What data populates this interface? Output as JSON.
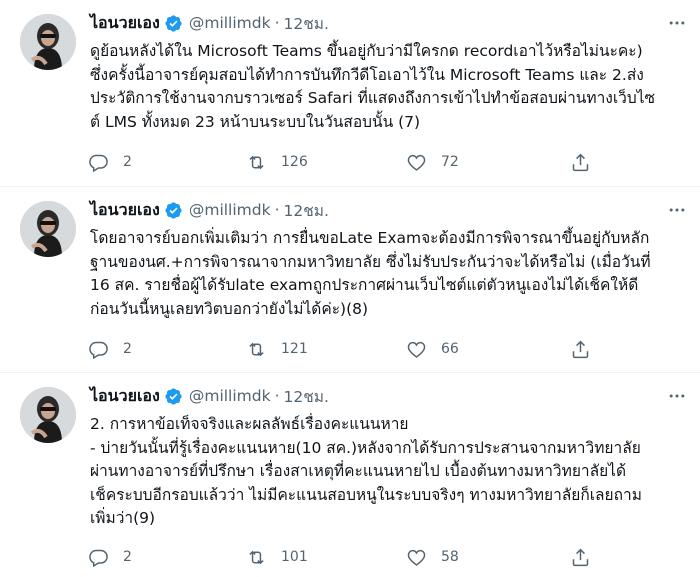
{
  "tweets": [
    {
      "name": "ไอนวยเอง",
      "handle": "@millimdk",
      "time": "12ชม.",
      "separator": "·",
      "lines": [
        "ดูย้อนหลังได้ใน Microsoft Teams ขึ้นอยู่กับว่ามีใครกด recordเอาไว้หรือไม่นะคะ)",
        "ซึ่งครั้งนี้อาจารย์คุมสอบได้ทำการบันทึกวีดีโอเอาไว้ใน Microsoft Teams และ 2.ส่ง",
        "ประวัติการใช้งานจากบราวเซอร์ Safari ที่แสดงถึงการเข้าไปทำข้อสอบผ่านทางเว็บไซ",
        "ต์ LMS ทั้งหมด 23 หน้าบนระบบในวันสอบนั้น (7)"
      ],
      "replies": "2",
      "retweets": "126",
      "likes": "72"
    },
    {
      "name": "ไอนวยเอง",
      "handle": "@millimdk",
      "time": "12ชม.",
      "separator": "·",
      "lines": [
        "โดยอาจารย์บอกเพิ่มเติมว่า การยื่นขอLate Examจะต้องมีการพิจารณาขึ้นอยู่กับหลัก",
        "ฐานของนศ.+การพิจารณาจากมหาวิทยาลัย ซึ่งไม่รับประกันว่าจะได้หรือไม่ (เมื่อวันที่",
        "16 สค. รายชื่อผู้ได้รับlate examถูกประกาศผ่านเว็บไซต์แต่ตัวหนูเองไม่ได้เช็คให้ดี",
        "ก่อนวันนี้หนูเลยทวิตบอกว่ายังไม่ได้ค่ะ)(8)"
      ],
      "replies": "2",
      "retweets": "121",
      "likes": "66"
    },
    {
      "name": "ไอนวยเอง",
      "handle": "@millimdk",
      "time": "12ชม.",
      "separator": "·",
      "lines": [
        "2. การหาข้อเท็จจริงและผลลัพธ์เรื่องคะแนนหาย",
        "- บ่ายวันนั้นที่รู้เรื่องคะแนนหาย(10 สค.)หลังจากได้รับการประสานจากมหาวิทยาลัย",
        "ผ่านทางอาจารย์ที่ปรึกษา เรื่องสาเหตุที่คะแนนหายไป เบื้องต้นทางมหาวิทยาลัยได้",
        "เช็คระบบอีกรอบแล้วว่า ไม่มีคะแนนสอบหนูในระบบจริงๆ ทางมหาวิทยาลัยก็เลยถาม",
        "เพิ่มว่า(9)"
      ],
      "replies": "2",
      "retweets": "101",
      "likes": "58"
    }
  ],
  "icons": {
    "verified": "verified-badge-icon",
    "more": "more-icon",
    "reply": "reply-icon",
    "retweet": "retweet-icon",
    "like": "like-icon",
    "share": "share-icon"
  },
  "colors": {
    "text": "#0f1419",
    "secondary": "#536471",
    "verified": "#1d9bf0",
    "divider": "#eff3f4"
  }
}
